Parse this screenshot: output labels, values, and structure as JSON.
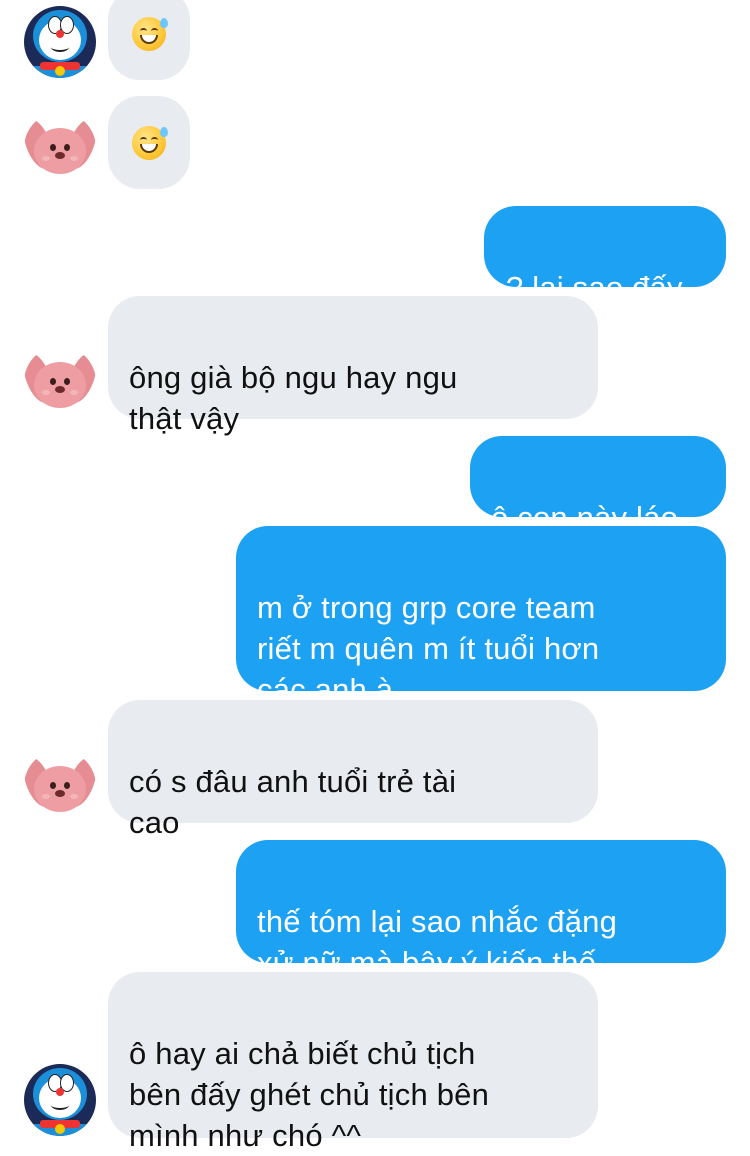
{
  "messages": [
    {
      "side": "incoming",
      "sender": "doraemon",
      "text": "😅"
    },
    {
      "side": "incoming",
      "sender": "loopy",
      "text": "😅"
    },
    {
      "side": "outgoing",
      "text": "? lại sao đấy"
    },
    {
      "side": "incoming",
      "sender": "loopy",
      "text": "ông già bộ ngu hay ngu\nthật vậy"
    },
    {
      "side": "outgoing",
      "text": "ô con này láo"
    },
    {
      "side": "outgoing",
      "text": "m ở trong grp core team\nriết m quên m ít tuổi hơn\ncác anh à"
    },
    {
      "side": "incoming",
      "sender": "loopy",
      "text": "có s đâu anh tuổi trẻ tài\ncao"
    },
    {
      "side": "outgoing",
      "text": "thế tóm lại sao nhắc đặng\nxử nữ mà bây ý kiến thế"
    },
    {
      "side": "incoming",
      "sender": "doraemon",
      "text": "ô hay ai chả biết chủ tịch\nbên đấy ghét chủ tịch bên\nmình như chó ^^"
    }
  ],
  "colors": {
    "incoming_bubble": "#e8ebef",
    "outgoing_bubble": "#1da1f2",
    "incoming_text": "#111111",
    "outgoing_text": "#ffffff"
  },
  "icons": {
    "emoji": "grinning-face-with-sweat-icon",
    "avatar_doraemon": "doraemon-avatar",
    "avatar_loopy": "loopy-avatar"
  }
}
